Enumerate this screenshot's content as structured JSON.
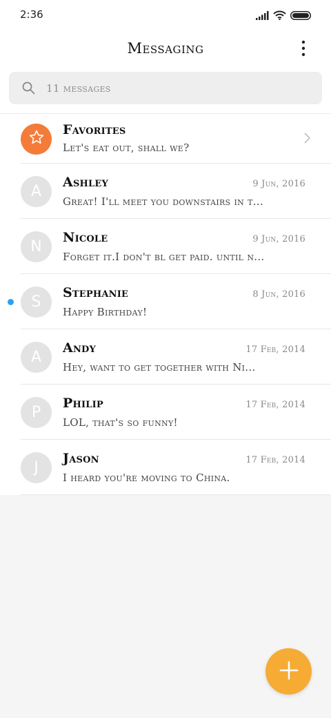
{
  "status_bar": {
    "time": "2:36",
    "icons": [
      "signal-icon",
      "wifi-icon",
      "battery-icon"
    ]
  },
  "header": {
    "title": "Messaging",
    "menu_icon": "more-vertical-icon"
  },
  "search": {
    "placeholder": "11 messages",
    "icon": "search-icon"
  },
  "favorites": {
    "title": "Favorites",
    "preview": "Let's eat out, shall we?",
    "icon": "star-icon",
    "color": "#f47c38"
  },
  "conversations": [
    {
      "initial": "A",
      "name": "Ashley",
      "date": "9 Jun, 2016",
      "preview": "Great! I'll meet you downstairs in t...",
      "unread": false
    },
    {
      "initial": "N",
      "name": "Nicole",
      "date": "9 Jun, 2016",
      "preview": "Forget it.I don't bl get paid. until n...",
      "unread": false
    },
    {
      "initial": "S",
      "name": "Stephanie",
      "date": "8 Jun, 2016",
      "preview": "Happy Birthday!",
      "unread": true
    },
    {
      "initial": "A",
      "name": "Andy",
      "date": "17 Feb, 2014",
      "preview": "Hey, want to get together with Ni...",
      "unread": false
    },
    {
      "initial": "P",
      "name": "Philip",
      "date": "17 Feb, 2014",
      "preview": "LOL, that's so funny!",
      "unread": false
    },
    {
      "initial": "J",
      "name": "Jason",
      "date": "17 Feb, 2014",
      "preview": "I heard you're moving to China.",
      "unread": false
    }
  ],
  "fab": {
    "icon": "plus-icon",
    "color": "#f6ab34"
  },
  "colors": {
    "unread_dot": "#2aa2ee",
    "avatar_bg": "#e3e3e3"
  }
}
